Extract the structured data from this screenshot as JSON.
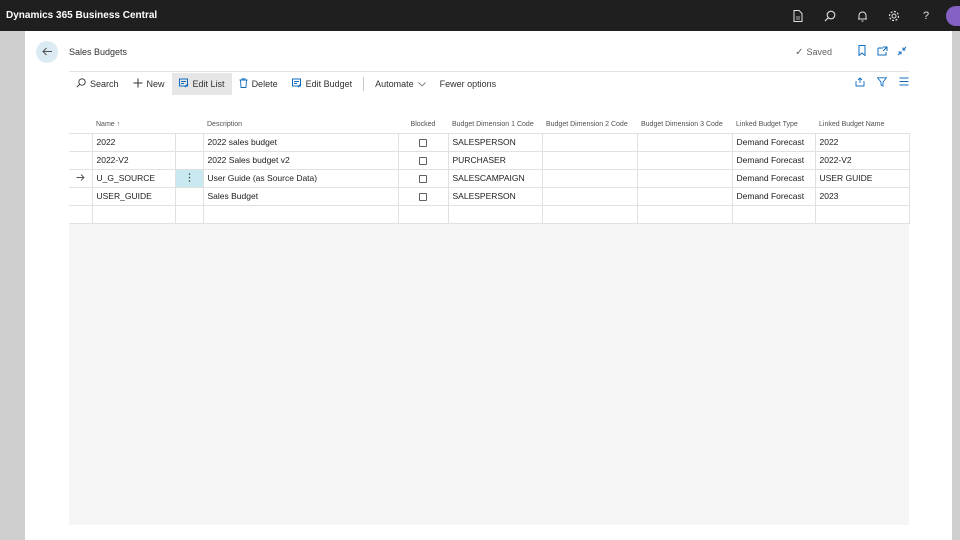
{
  "app": {
    "title": "Dynamics 365 Business Central",
    "icons": [
      "document-icon",
      "search-icon",
      "bell-icon",
      "gear-icon",
      "help-icon"
    ],
    "help_glyph": "?"
  },
  "page": {
    "title": "Sales Budgets",
    "status": "Saved"
  },
  "actions": {
    "search": "Search",
    "new": "New",
    "edit_list": "Edit List",
    "delete": "Delete",
    "edit_budget": "Edit Budget",
    "automate": "Automate",
    "fewer_options": "Fewer options"
  },
  "table": {
    "columns": {
      "name": "Name ↑",
      "description": "Description",
      "blocked": "Blocked",
      "dim1": "Budget Dimension 1 Code",
      "dim2": "Budget Dimension 2 Code",
      "dim3": "Budget Dimension 3 Code",
      "linked_type": "Linked Budget Type",
      "linked_name": "Linked Budget Name"
    },
    "rows": [
      {
        "name": "2022",
        "description": "2022 sales budget",
        "blocked": false,
        "dim1": "SALESPERSON",
        "dim2": "",
        "dim3": "",
        "linked_type": "Demand Forecast",
        "linked_name": "2022",
        "current": false
      },
      {
        "name": "2022-V2",
        "description": "2022 Sales budget v2",
        "blocked": false,
        "dim1": "PURCHASER",
        "dim2": "",
        "dim3": "",
        "linked_type": "Demand Forecast",
        "linked_name": "2022-V2",
        "current": false
      },
      {
        "name": "U_G_SOURCE",
        "description": "User Guide (as Source Data)",
        "blocked": false,
        "dim1": "SALESCAMPAIGN",
        "dim2": "",
        "dim3": "",
        "linked_type": "Demand Forecast",
        "linked_name": "USER GUIDE",
        "current": true
      },
      {
        "name": "USER_GUIDE",
        "description": "Sales Budget",
        "blocked": false,
        "dim1": "SALESPERSON",
        "dim2": "",
        "dim3": "",
        "linked_type": "Demand Forecast",
        "linked_name": "2023",
        "current": false
      }
    ]
  },
  "colors": {
    "appbar": "#1f1f1f",
    "accent": "#0f6cbd",
    "selected_cell": "#c8e9ef",
    "avatar": "#8661c5"
  }
}
